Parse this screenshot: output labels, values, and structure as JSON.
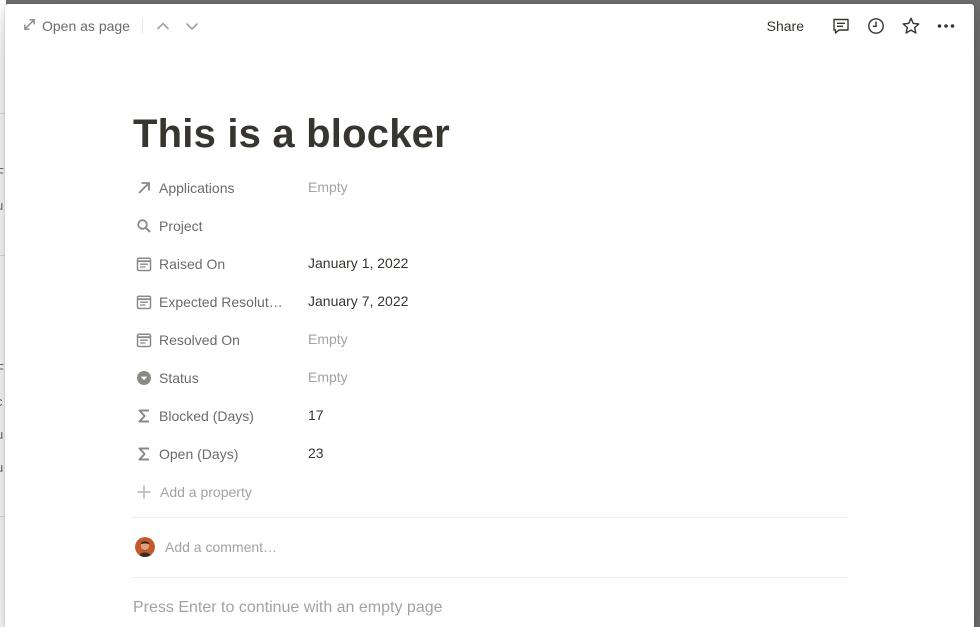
{
  "background_fragments": [
    "F",
    "u",
    "F",
    "c",
    "u",
    "u"
  ],
  "topbar": {
    "open_as_page_label": "Open as page",
    "share_label": "Share"
  },
  "page": {
    "title": "This is a blocker"
  },
  "properties": [
    {
      "icon": "arrow-up-right-icon",
      "name": "Applications",
      "value": "Empty",
      "empty": true
    },
    {
      "icon": "search-icon",
      "name": "Project",
      "value": "",
      "empty": false
    },
    {
      "icon": "calendar-icon",
      "name": "Raised On",
      "value": "January 1, 2022",
      "empty": false
    },
    {
      "icon": "calendar-icon",
      "name": "Expected Resolut…",
      "value": "January 7, 2022",
      "empty": false
    },
    {
      "icon": "calendar-icon",
      "name": "Resolved On",
      "value": "Empty",
      "empty": true
    },
    {
      "icon": "select-icon",
      "name": "Status",
      "value": "Empty",
      "empty": true
    },
    {
      "icon": "sigma-icon",
      "name": "Blocked (Days)",
      "value": "17",
      "empty": false
    },
    {
      "icon": "sigma-icon",
      "name": "Open (Days)",
      "value": "23",
      "empty": false
    }
  ],
  "add_property_label": "Add a property",
  "comment": {
    "placeholder": "Add a comment…"
  },
  "empty_page_hint": "Press Enter to continue with an empty page",
  "colors": {
    "text": "#37352f",
    "muted": "#6b6b68",
    "placeholder": "#a3a29f",
    "overlay": "#6f6f6f"
  }
}
